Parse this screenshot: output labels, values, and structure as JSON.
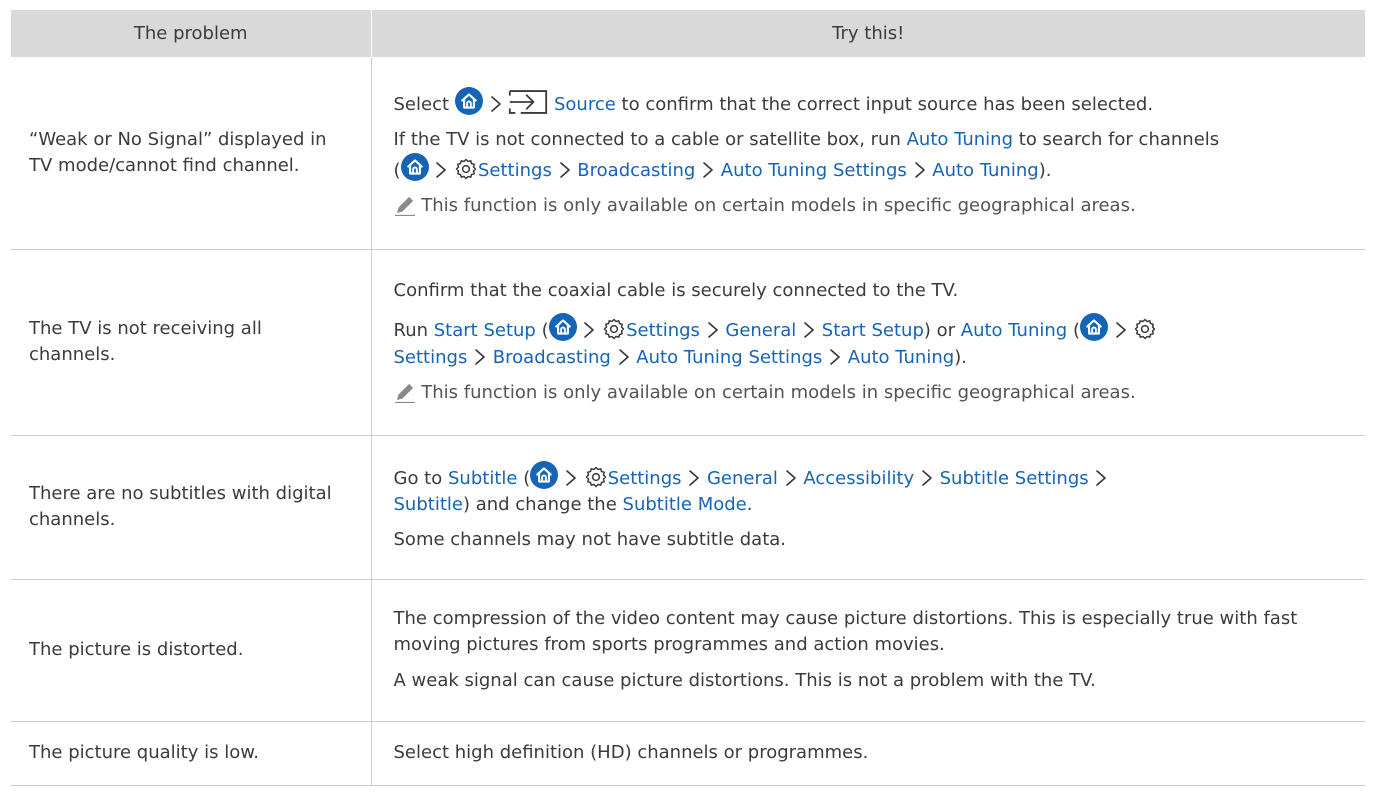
{
  "table": {
    "headers": [
      "The problem",
      "Try this!"
    ],
    "rows": [
      {
        "problem": "“Weak or No Signal” displayed in TV mode/cannot find channel.",
        "select_word": "Select",
        "source_label": "Source",
        "line1_tail": "to confirm that the correct input source has been selected.",
        "line2_pre": "If the TV is not connected to a cable or satellite box, run",
        "auto_tuning": "Auto Tuning",
        "line2_post": "to search for channels",
        "open_paren": "(",
        "settings": "Settings",
        "broadcasting": "Broadcasting",
        "auto_tuning_settings": "Auto Tuning Settings",
        "close_paren": ").",
        "note": "This function is only available on certain models in specific geographical areas."
      },
      {
        "problem": "The TV is not receiving all channels.",
        "line1": "Confirm that the coaxial cable is securely connected to the TV.",
        "run_word": "Run",
        "start_setup": "Start Setup",
        "open_paren": "(",
        "settings": "Settings",
        "general": "General",
        "mid_text": ") or",
        "auto_tuning": "Auto Tuning",
        "broadcasting": "Broadcasting",
        "auto_tuning_settings": "Auto Tuning Settings",
        "close_paren": ").",
        "note": "This function is only available on certain models in specific geographical areas."
      },
      {
        "problem": "There are no subtitles with digital channels.",
        "go_to": "Go to",
        "subtitle": "Subtitle",
        "open_paren": "(",
        "settings": "Settings",
        "general": "General",
        "accessibility": "Accessibility",
        "subtitle_settings": "Subtitle Settings",
        "change_text": ") and change the",
        "subtitle_mode": "Subtitle Mode",
        "period": ".",
        "line2": "Some channels may not have subtitle data."
      },
      {
        "problem": "The picture is distorted.",
        "line1": "The compression of the video content may cause picture distortions. This is especially true with fast moving pictures from sports programmes and action movies.",
        "line2": "A weak signal can cause picture distortions. This is not a problem with the TV."
      },
      {
        "problem": "The picture quality is low.",
        "line1": "Select high definition (HD) channels or programmes."
      }
    ]
  },
  "colors": {
    "link": "#1564b6",
    "header_bg": "#d9d9d9",
    "text": "#3b3b3b",
    "border": "#cfcfcf"
  },
  "icons": [
    "home-icon",
    "chevron-right-icon",
    "source-icon",
    "gear-icon",
    "pencil-note-icon"
  ]
}
